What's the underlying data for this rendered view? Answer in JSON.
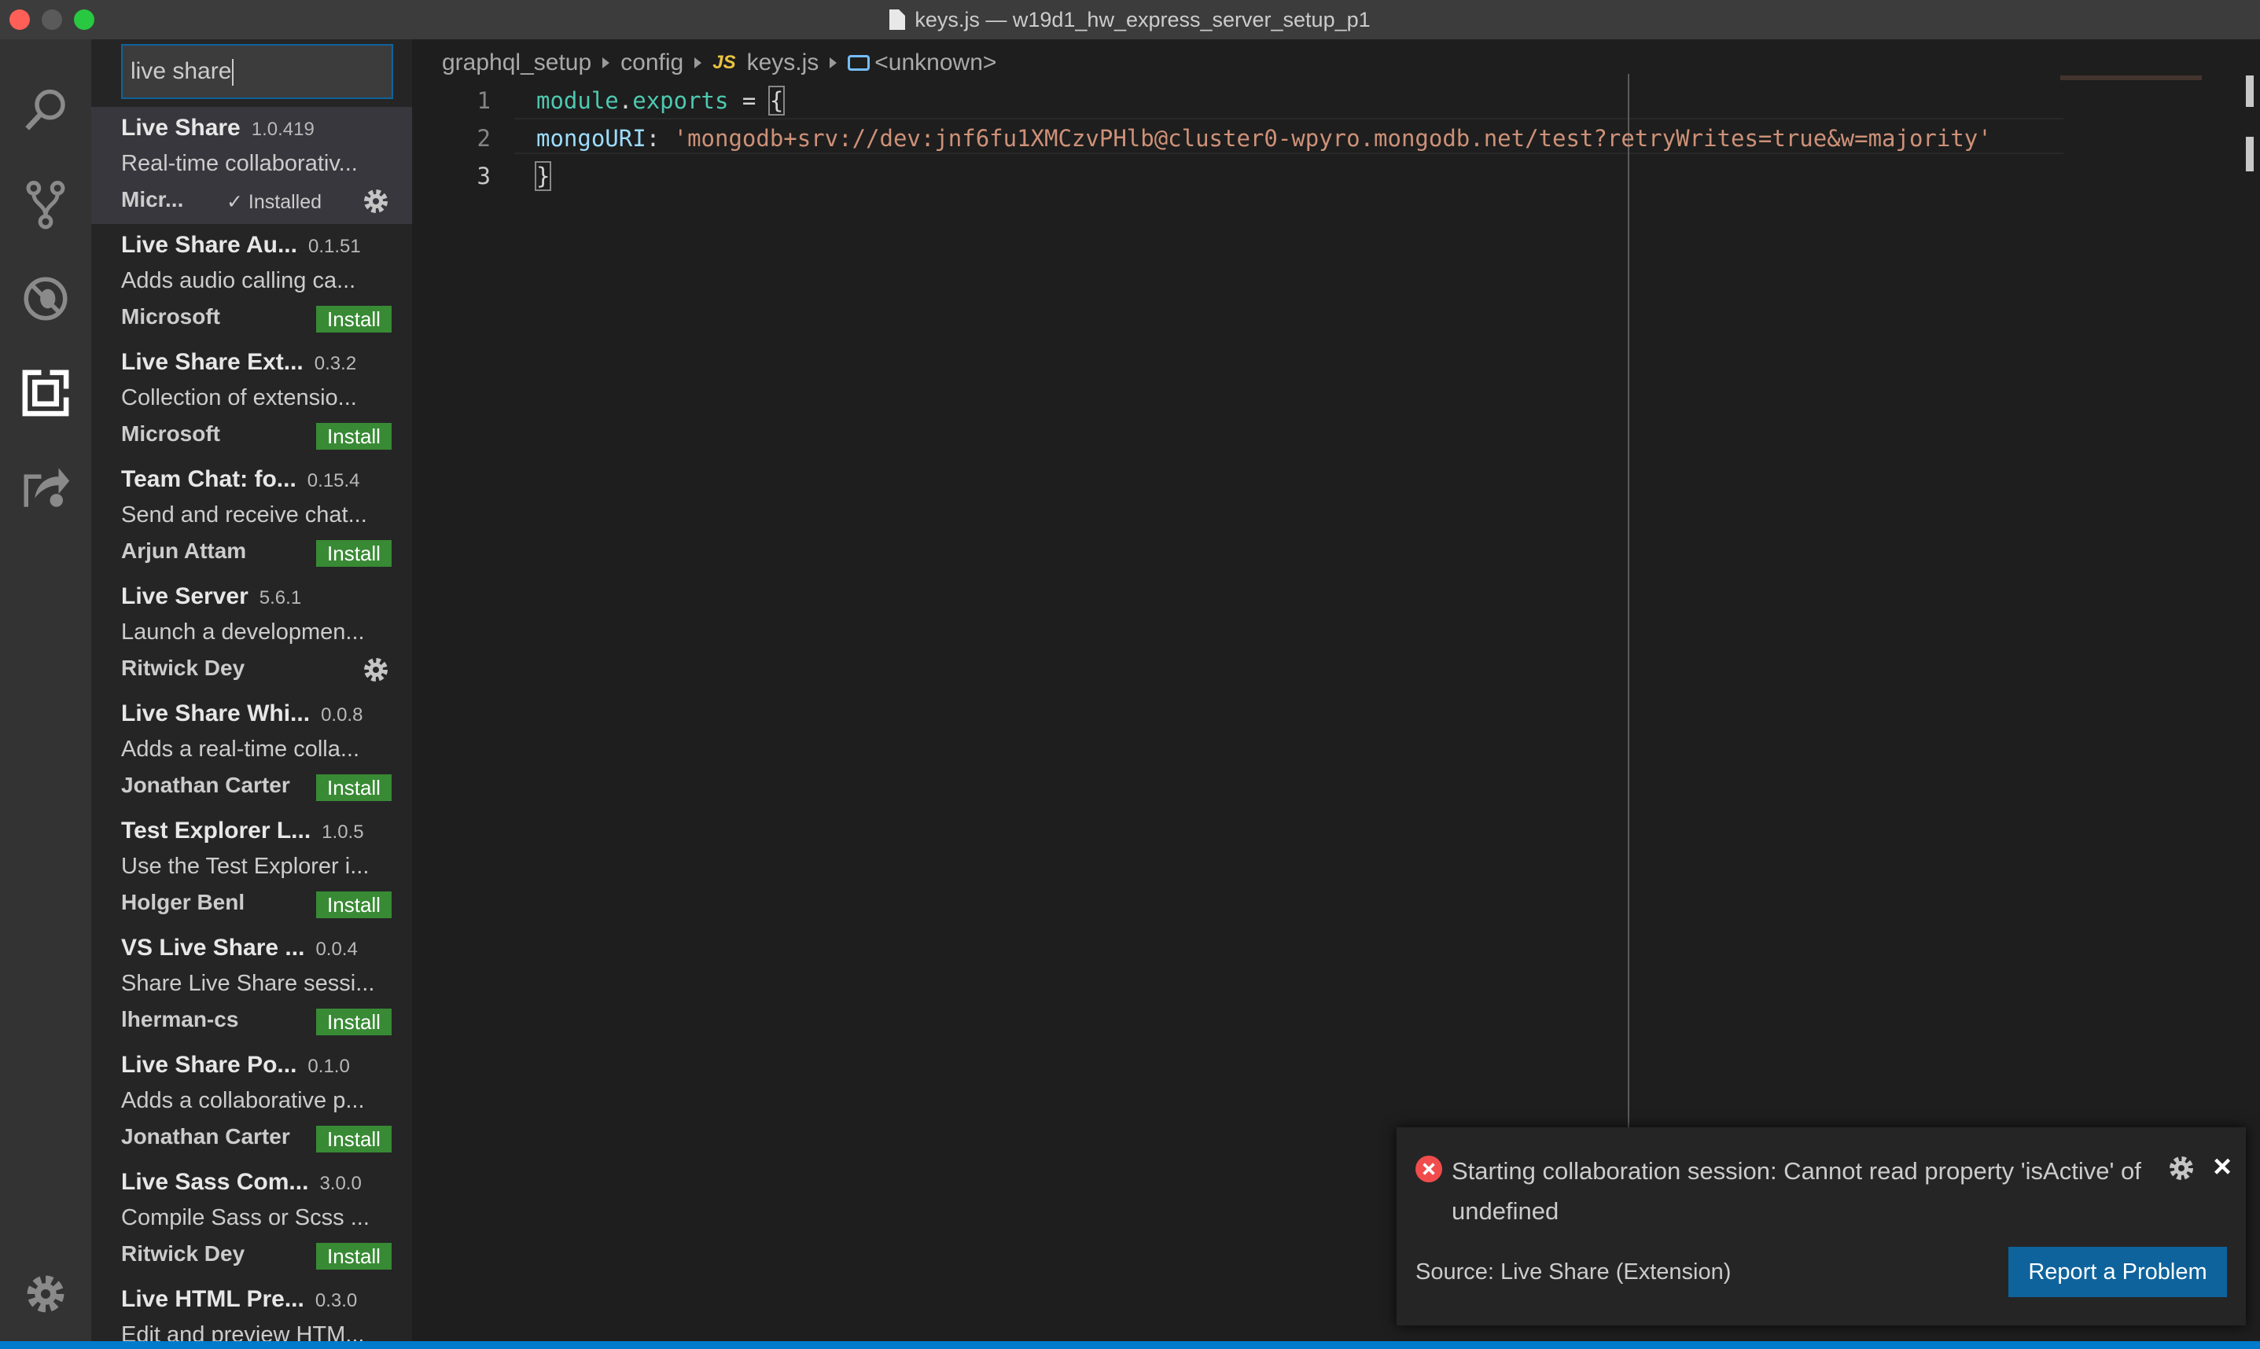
{
  "window": {
    "title": "keys.js — w19d1_hw_express_server_setup_p1"
  },
  "activity_bar": {
    "icons": [
      "search-icon",
      "source-control-icon",
      "debug-icon",
      "extensions-icon",
      "live-share-icon",
      "settings-gear-icon"
    ]
  },
  "extensions": {
    "search_value": "live share",
    "items": [
      {
        "name": "Live Share",
        "version": "1.0.419",
        "description": "Real-time collaborativ...",
        "publisher": "Micr...",
        "status": "Installed",
        "action": "gear"
      },
      {
        "name": "Live Share Au...",
        "version": "0.1.51",
        "description": "Adds audio calling ca...",
        "publisher": "Microsoft",
        "action": "Install"
      },
      {
        "name": "Live Share Ext...",
        "version": "0.3.2",
        "description": "Collection of extensio...",
        "publisher": "Microsoft",
        "action": "Install"
      },
      {
        "name": "Team Chat: fo...",
        "version": "0.15.4",
        "description": "Send and receive chat...",
        "publisher": "Arjun Attam",
        "action": "Install"
      },
      {
        "name": "Live Server",
        "version": "5.6.1",
        "description": "Launch a developmen...",
        "publisher": "Ritwick Dey",
        "action": "gear"
      },
      {
        "name": "Live Share Whi...",
        "version": "0.0.8",
        "description": "Adds a real-time colla...",
        "publisher": "Jonathan Carter",
        "action": "Install"
      },
      {
        "name": "Test Explorer L...",
        "version": "1.0.5",
        "description": "Use the Test Explorer i...",
        "publisher": "Holger Benl",
        "action": "Install"
      },
      {
        "name": "VS Live Share ...",
        "version": "0.0.4",
        "description": "Share Live Share sessi...",
        "publisher": "lherman-cs",
        "action": "Install"
      },
      {
        "name": "Live Share Po...",
        "version": "0.1.0",
        "description": "Adds a collaborative p...",
        "publisher": "Jonathan Carter",
        "action": "Install"
      },
      {
        "name": "Live Sass Com...",
        "version": "3.0.0",
        "description": "Compile Sass or Scss ...",
        "publisher": "Ritwick Dey",
        "action": "Install"
      },
      {
        "name": "Live HTML Pre...",
        "version": "0.3.0",
        "description": "Edit and preview HTM...",
        "publisher": "",
        "action": ""
      }
    ]
  },
  "breadcrumb": {
    "items": [
      "graphql_setup",
      "config",
      "keys.js",
      "<unknown>"
    ],
    "js_badge": "JS"
  },
  "code": {
    "lines": [
      {
        "n": "1",
        "tokens": [
          [
            "module",
            "k-var"
          ],
          [
            ".",
            "k-punc"
          ],
          [
            "exports",
            "k-var"
          ],
          [
            " = ",
            "k-punc"
          ],
          [
            "{",
            "k-punc"
          ]
        ]
      },
      {
        "n": "2",
        "tokens": [
          [
            "  mongoURI",
            "k-prop"
          ],
          [
            ": ",
            "k-punc"
          ],
          [
            "'mongodb+srv://dev:jnf6fu1XMCzvPHlb@cluster0-wpyro.mongodb.net/test?retryWrites=true&w=majority'",
            "k-str"
          ]
        ]
      },
      {
        "n": "3",
        "tokens": [
          [
            "}",
            "k-punc"
          ]
        ]
      }
    ]
  },
  "notification": {
    "message": "Starting collaboration session: Cannot read property 'isActive' of undefined",
    "source": "Source: Live Share (Extension)",
    "button": "Report a Problem",
    "close": "×"
  },
  "colors": {
    "install_green": "#388a34",
    "accent_blue": "#0e639c",
    "status_blue": "#007acc",
    "error_red": "#f14c4c"
  }
}
